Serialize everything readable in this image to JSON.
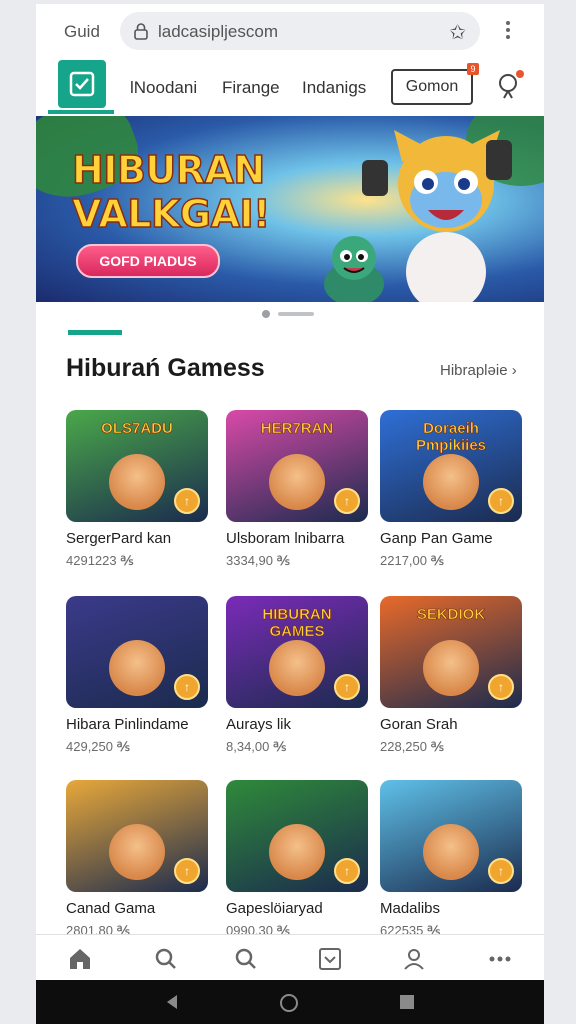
{
  "browser": {
    "title": "Guid",
    "url": "ladcasipljescom",
    "lock_icon": "lock-icon",
    "star_icon": "bookmark-star-icon",
    "menu_icon": "more-vertical-icon"
  },
  "nav": {
    "logo_icon": "checkbox-icon",
    "links": [
      "lNoodani",
      "Firange",
      "Indanigs"
    ],
    "button": "Gomon",
    "button_badge": "9",
    "bell_icon": "notification-bell-icon"
  },
  "banner": {
    "title_line1": "HIBURAN",
    "title_line2": "VALKGAI!",
    "button": "GOFD PIADUS",
    "colors": {
      "accent": "#ffd23a",
      "button": "#d9285e"
    }
  },
  "section": {
    "title": "Hiburań Gamess",
    "link": "Hibraplǝie",
    "accent": "#16a58a"
  },
  "games": [
    {
      "title": "SergerPard kan",
      "meta": "4291223 ℁",
      "thumb_text": "OLS7ADU",
      "bg": "#4aa84a"
    },
    {
      "title": "Ulsboram lnibarra",
      "meta": "3334,90 ℁",
      "thumb_text": "HER7RAN",
      "bg": "#d94aa8"
    },
    {
      "title": "Ganp Pan Game",
      "meta": "2217,00 ℁",
      "thumb_text": "Doraeih Pmpikiies",
      "bg": "#2f6fd6"
    },
    {
      "title": "Hibara Pinlindame",
      "meta": "429,250 ℁",
      "thumb_text": "",
      "bg": "#3b3a8a"
    },
    {
      "title": "Aurays lik",
      "meta": "8,34,00 ℁",
      "thumb_text": "HIBURAN GAMES",
      "bg": "#7a2bb8"
    },
    {
      "title": "Goran Srah",
      "meta": "228,250 ℁",
      "thumb_text": "SEKDIOK",
      "bg": "#e86a2a"
    },
    {
      "title": "Canad Gama",
      "meta": "2801,80 ℁",
      "thumb_text": "",
      "bg": "#e8a83a"
    },
    {
      "title": "Gapeslöiaryad",
      "meta": "0990,30 ℁",
      "thumb_text": "",
      "bg": "#2f8a3a"
    },
    {
      "title": "Madalibs",
      "meta": "622535 ℁",
      "thumb_text": "",
      "bg": "#5fc0e8"
    }
  ],
  "bottom_tabs": [
    "home-icon",
    "search-icon",
    "search-icon",
    "checkbox-icon",
    "profile-icon",
    "more-horizontal-icon"
  ],
  "system_nav": [
    "back-icon",
    "home-circle-icon",
    "recents-icon"
  ]
}
